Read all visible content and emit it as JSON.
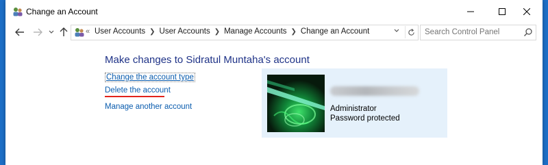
{
  "window": {
    "title": "Change an Account",
    "controls": {
      "minimize_icon": "minimize-icon",
      "maximize_icon": "maximize-icon",
      "close_icon": "close-icon"
    }
  },
  "nav": {
    "back_icon": "back-arrow-icon",
    "forward_icon": "forward-arrow-icon",
    "recent_icon": "chevron-down-icon",
    "up_icon": "up-arrow-icon"
  },
  "address": {
    "overflow": "«",
    "breadcrumbs": [
      "User Accounts",
      "User Accounts",
      "Manage Accounts",
      "Change an Account"
    ],
    "dropdown_icon": "chevron-down-icon",
    "refresh_icon": "refresh-icon"
  },
  "search": {
    "placeholder": "Search Control Panel",
    "icon": "search-icon"
  },
  "main": {
    "title": "Make changes to Sidratul Muntaha's account",
    "links": {
      "change_type": "Change the account type",
      "delete": "Delete the account",
      "manage_another": "Manage another account"
    },
    "highlight_color": "#e2231a"
  },
  "account": {
    "role": "Administrator",
    "status": "Password protected",
    "panel_color": "#e5f1fb"
  },
  "colors": {
    "link": "#0a5cae",
    "heading": "#1e3287",
    "desktop": "#1d6fc7"
  }
}
